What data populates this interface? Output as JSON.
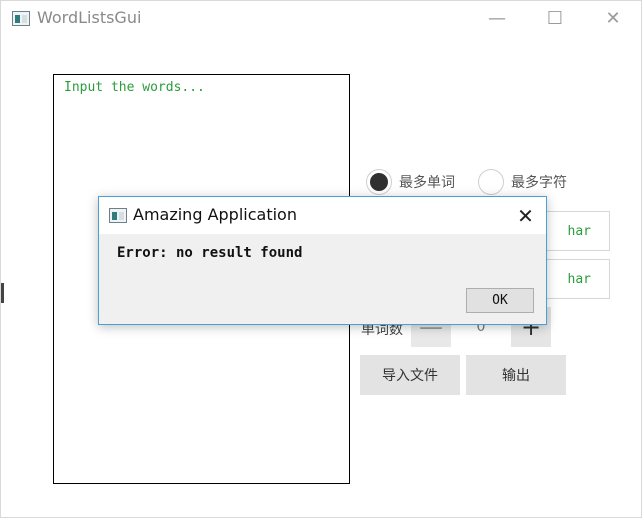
{
  "window": {
    "title": "WordListsGui",
    "minimize_glyph": "—",
    "maximize_glyph": "☐",
    "close_glyph": "✕"
  },
  "text_area": {
    "placeholder": "Input the words..."
  },
  "options": {
    "max_words_label": "最多单词",
    "max_words_selected": true,
    "max_chars_label": "最多字符",
    "max_chars_selected": false
  },
  "inputs": {
    "head_char_partial": "har",
    "tail_char_partial": "har"
  },
  "word_count": {
    "label": "单词数",
    "minus_glyph": "—",
    "value": "0",
    "plus_glyph": "+"
  },
  "buttons": {
    "import_label": "导入文件",
    "output_label": "输出"
  },
  "dialog": {
    "title": "Amazing Application",
    "close_glyph": "✕",
    "message": "Error: no result found",
    "ok_label": "OK"
  }
}
